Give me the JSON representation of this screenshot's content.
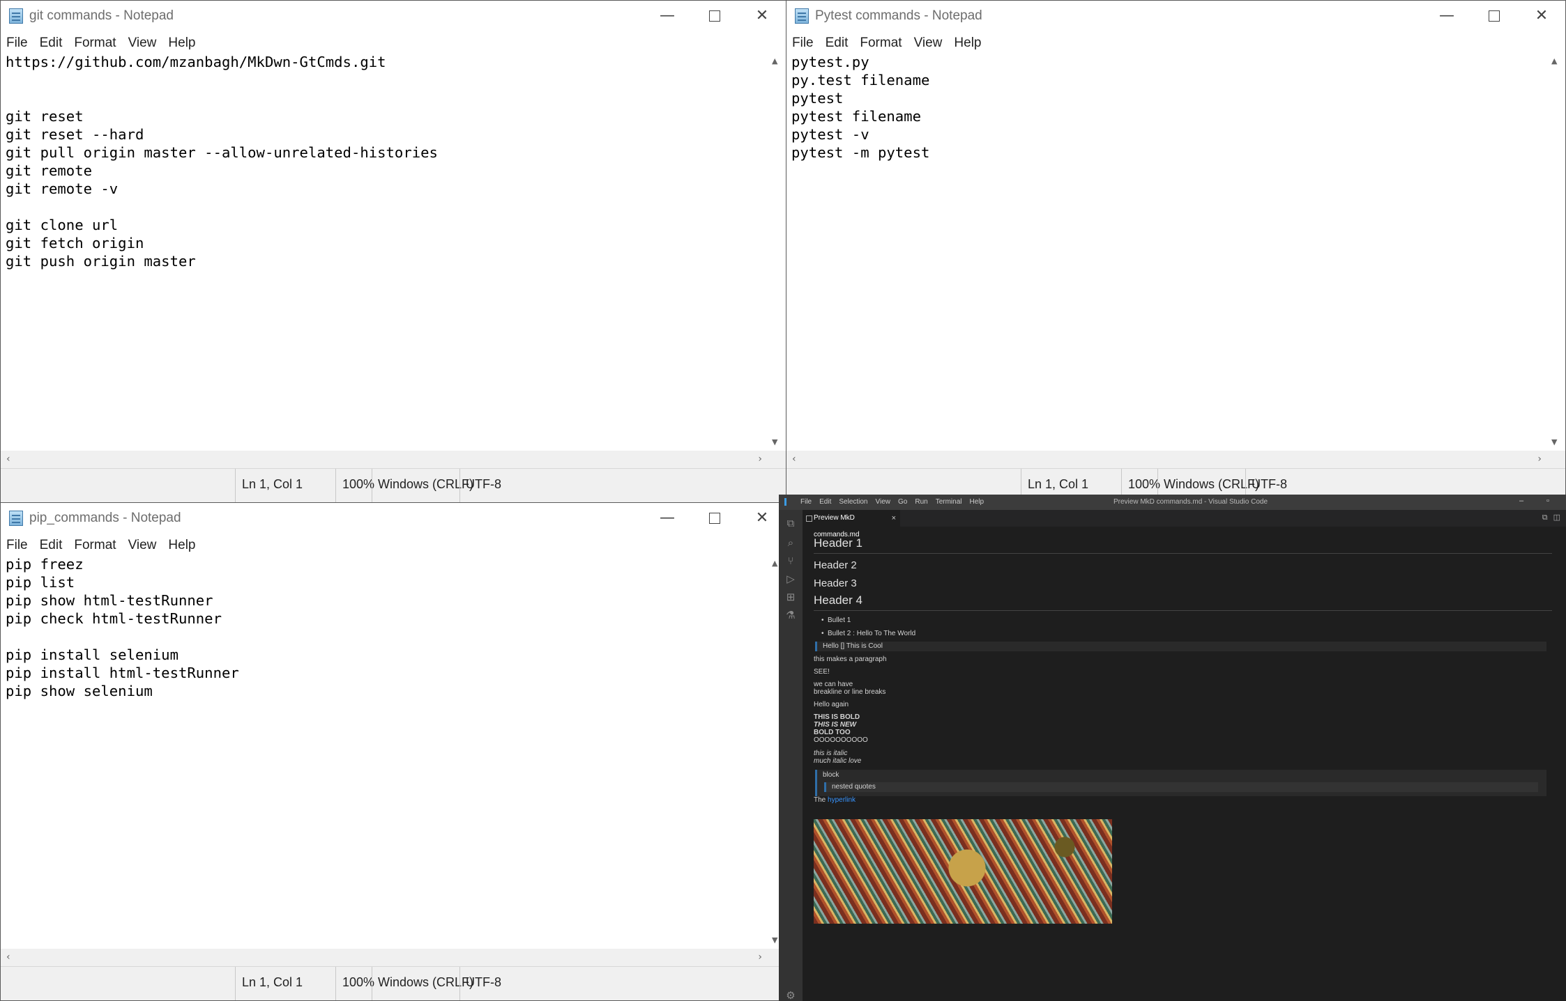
{
  "notepad_git": {
    "title": "git commands - Notepad",
    "menu": [
      "File",
      "Edit",
      "Format",
      "View",
      "Help"
    ],
    "content": "https://github.com/mzanbagh/MkDwn-GtCmds.git\n\n\ngit reset\ngit reset --hard\ngit pull origin master --allow-unrelated-histories\ngit remote\ngit remote -v\n\ngit clone url\ngit fetch origin\ngit push origin master",
    "status": {
      "position": "Ln 1, Col 1",
      "zoom": "100%",
      "line_ending": "Windows (CRLF)",
      "encoding": "UTF-8"
    }
  },
  "notepad_pytest": {
    "title": "Pytest commands - Notepad",
    "menu": [
      "File",
      "Edit",
      "Format",
      "View",
      "Help"
    ],
    "content": "pytest.py\npy.test filename\npytest\npytest filename\npytest -v\npytest -m pytest",
    "status": {
      "position": "Ln 1, Col 1",
      "zoom": "100%",
      "line_ending": "Windows (CRLF)",
      "encoding": "UTF-8"
    }
  },
  "notepad_pip": {
    "title": "pip_commands - Notepad",
    "menu": [
      "File",
      "Edit",
      "Format",
      "View",
      "Help"
    ],
    "content": "pip freez\npip list\npip show html-testRunner\npip check html-testRunner\n\npip install selenium\npip install html-testRunner\npip show selenium",
    "status": {
      "position": "Ln 1, Col 1",
      "zoom": "100%",
      "line_ending": "Windows (CRLF)",
      "encoding": "UTF-8"
    }
  },
  "vscode": {
    "menu": [
      "File",
      "Edit",
      "Selection",
      "View",
      "Go",
      "Run",
      "Terminal",
      "Help"
    ],
    "window_title": "Preview MkD commands.md - Visual Studio Code",
    "tab_label": "Preview MkD commands.md",
    "activity_icons": [
      "explorer-icon",
      "search-icon",
      "source-control-icon",
      "run-debug-icon",
      "extensions-icon",
      "testing-icon",
      "settings-icon"
    ],
    "preview": {
      "h1": "Header 1",
      "h2": "Header 2",
      "h3": "Header 3",
      "h4": "Header 4",
      "bullet1": "Bullet 1",
      "bullet2": "Bullet 2 : Hello To The World",
      "quote1": "Hello [] This is Cool",
      "para1": "this makes a paragraph",
      "see": "SEE!",
      "line_a": "we can have",
      "line_b": "breakline or line breaks",
      "hello_again": "Hello again",
      "bold1": "THIS IS BOLD",
      "bold_italic": "THIS IS NEW",
      "bold2": "BOLD TOO",
      "circles": "OOOOOOOOOO",
      "italic1": "this is italic",
      "italic2": "much italic love",
      "block": "block",
      "nested": "nested quotes",
      "link_prefix": "The",
      "link_text": "hyperlink"
    }
  }
}
